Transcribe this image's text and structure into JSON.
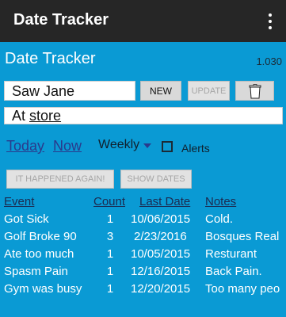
{
  "appbar": {
    "title": "Date Tracker"
  },
  "header": {
    "title": "Date Tracker",
    "version": "1.030"
  },
  "form": {
    "event_value": "Saw Jane",
    "place_prefix": "At ",
    "place_value": "store",
    "new_label": "NEW",
    "update_label": "UPDATE"
  },
  "controls": {
    "today_label": "Today",
    "now_label": "Now",
    "period_value": "Weekly",
    "alerts_label": "Alerts",
    "alerts_checked": false,
    "again_label": "IT HAPPENED AGAIN!",
    "show_label": "SHOW DATES"
  },
  "table": {
    "headers": {
      "event": "Event",
      "count": "Count",
      "date": "Last Date",
      "notes": "Notes"
    },
    "rows": [
      {
        "event": "Got Sick",
        "count": "1",
        "date": "10/06/2015",
        "notes": "Cold."
      },
      {
        "event": "Golf Broke 90",
        "count": "3",
        "date": "2/23/2016",
        "notes": "Bosques Real"
      },
      {
        "event": "Ate too much",
        "count": "1",
        "date": "10/05/2015",
        "notes": "Resturant"
      },
      {
        "event": "Spasm Pain",
        "count": "1",
        "date": "12/16/2015",
        "notes": "Back Pain."
      },
      {
        "event": "Gym was busy",
        "count": "1",
        "date": "12/20/2015",
        "notes": "Too many peo"
      }
    ]
  },
  "colors": {
    "background": "#0a9ad4",
    "appbar": "#262626",
    "link": "#2a3a8c"
  }
}
